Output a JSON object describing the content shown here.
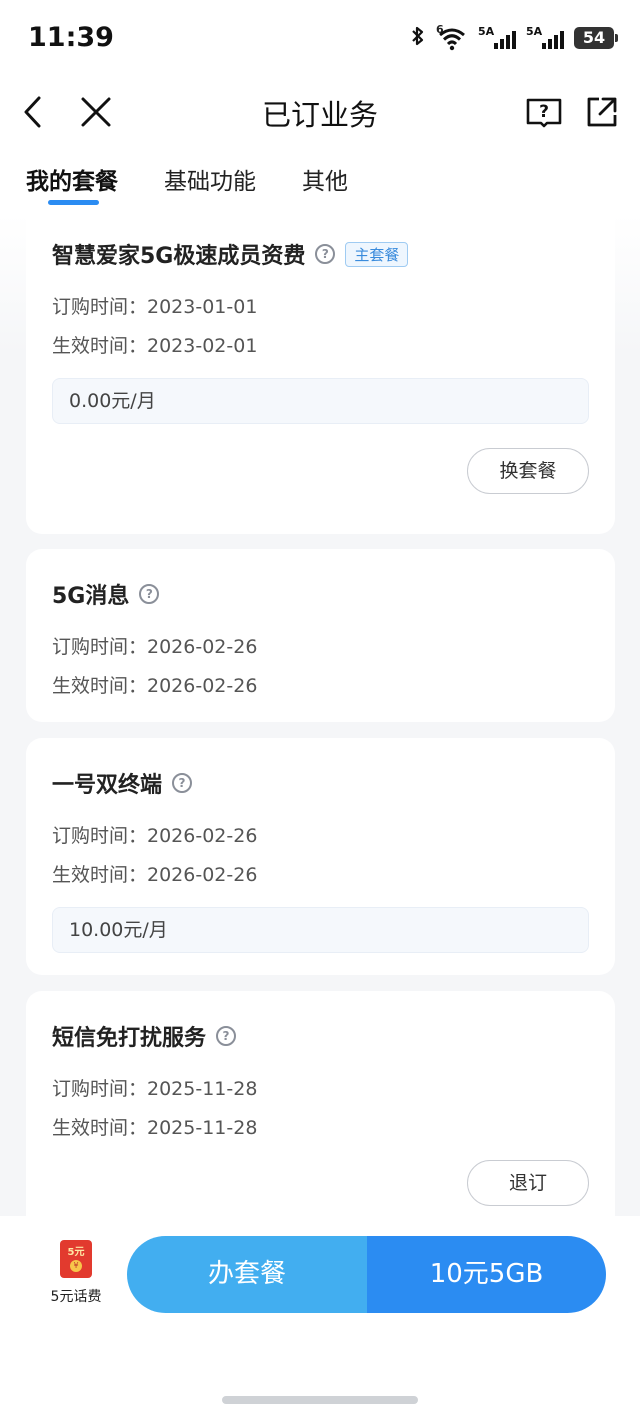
{
  "status_bar": {
    "time": "11:39",
    "icons": [
      "bluetooth-icon",
      "wifi-icon",
      "signal-icon",
      "signal-icon",
      "battery-icon"
    ],
    "wifi_label": "6",
    "sim1_label": "5A",
    "sim2_label": "5A",
    "battery": "54"
  },
  "nav": {
    "title": "已订业务",
    "icons": [
      "back-icon",
      "close-icon",
      "help-book-icon",
      "share-icon"
    ]
  },
  "tabs": [
    {
      "label": "我的套餐",
      "active": true
    },
    {
      "label": "基础功能",
      "active": false
    },
    {
      "label": "其他",
      "active": false
    }
  ],
  "cards": [
    {
      "title": "智慧爱家5G极速成员资费",
      "tag": "主套餐",
      "order_time": "订购时间：2023-01-01",
      "effective_time": "生效时间：2023-02-01",
      "price": "0.00元/月",
      "button": "换套餐"
    },
    {
      "title": "5G消息",
      "order_time": "订购时间：2026-02-26",
      "effective_time": "生效时间：2026-02-26"
    },
    {
      "title": "一号双终端",
      "order_time": "订购时间：2026-02-26",
      "effective_time": "生效时间：2026-02-26",
      "price": "10.00元/月"
    },
    {
      "title": "短信免打扰服务",
      "order_time": "订购时间：2025-11-28",
      "effective_time": "生效时间：2025-11-28",
      "button": "退订"
    }
  ],
  "bottom": {
    "promo_amount": "5元",
    "promo_coin": "¥",
    "promo_label": "5元话费",
    "cta_left": "办套餐",
    "cta_right": "10元5GB"
  },
  "colors": {
    "accent": "#2b8cf2",
    "cta_light": "#42aef0",
    "tag_text": "#3a8bdc",
    "redpack": "#e23a2e"
  }
}
